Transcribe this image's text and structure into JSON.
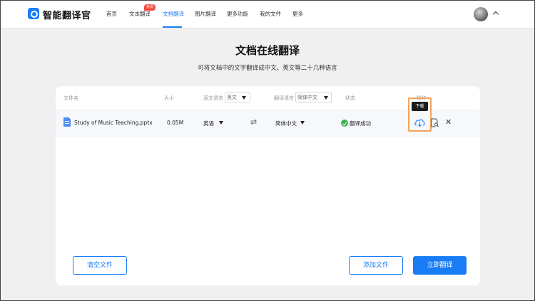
{
  "nav": {
    "brand": "智能翻译官",
    "items": [
      "首页",
      "文本翻译",
      "文档翻译",
      "图片翻译",
      "更多功能",
      "我的文件",
      "更多"
    ],
    "badge": "免费",
    "accent": "#1a7cf5"
  },
  "page": {
    "title": "文档在线翻译",
    "subtitle": "可将文档中的文字翻译成中文、英文等二十几种语言"
  },
  "table": {
    "headers": {
      "file_name": "文件名",
      "size": "大小",
      "source_lang": "源文语言",
      "source_select": "英文",
      "target_lang": "翻译语言",
      "target_select": "简体中文",
      "status": "状态",
      "action": "操作"
    },
    "rows": [
      {
        "file_name": "Study of Music Teaching.pptx",
        "size": "0.05M",
        "source_lang": "英语",
        "target_lang": "简体中文",
        "status": "翻译成功",
        "status_color": "#37b24d"
      }
    ],
    "tooltip": "下载"
  },
  "actions": {
    "clear": "清空文件",
    "add": "添加文件",
    "translate": "立即翻译"
  }
}
